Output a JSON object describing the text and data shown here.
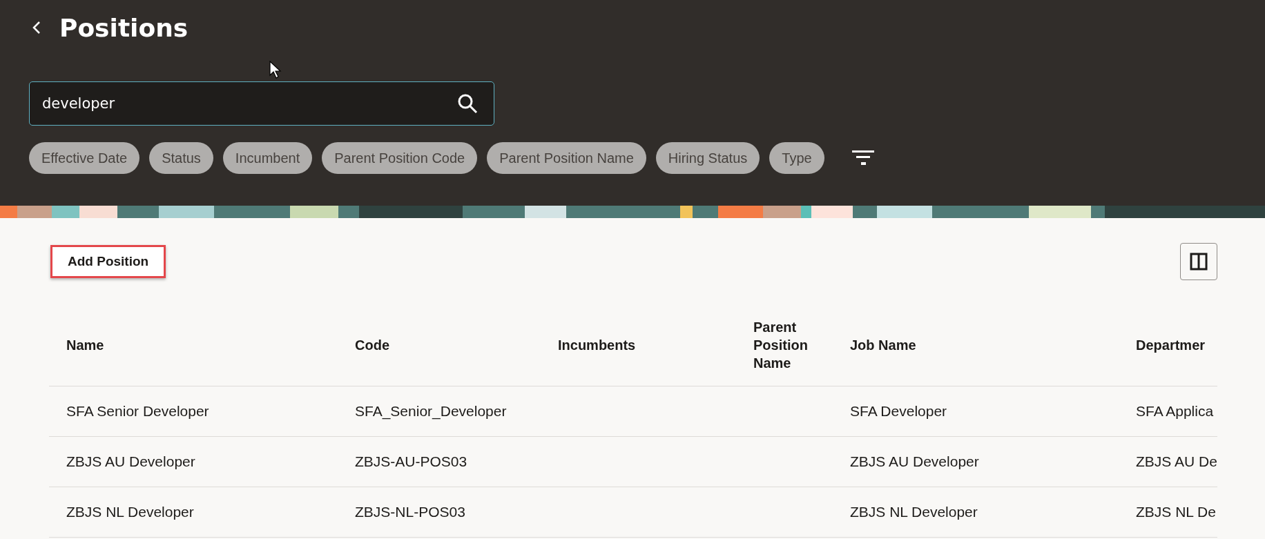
{
  "header": {
    "title": "Positions",
    "search": {
      "value": "developer"
    },
    "filters": [
      {
        "label": "Effective Date"
      },
      {
        "label": "Status"
      },
      {
        "label": "Incumbent"
      },
      {
        "label": "Parent Position Code"
      },
      {
        "label": "Parent Position Name"
      },
      {
        "label": "Hiring Status"
      },
      {
        "label": "Type"
      }
    ]
  },
  "toolbar": {
    "add_button": "Add Position"
  },
  "table": {
    "columns": [
      "Name",
      "Code",
      "Incumbents",
      "Parent Position Name",
      "Job Name",
      "Departmer"
    ],
    "rows": [
      [
        "SFA Senior Developer",
        "SFA_Senior_Developer",
        "",
        "",
        "SFA Developer",
        "SFA Applica"
      ],
      [
        "ZBJS AU Developer",
        "ZBJS-AU-POS03",
        "",
        "",
        "ZBJS AU Developer",
        "ZBJS AU De"
      ],
      [
        "ZBJS NL Developer",
        "ZBJS-NL-POS03",
        "",
        "",
        "ZBJS NL Developer",
        "ZBJS NL De"
      ]
    ]
  }
}
